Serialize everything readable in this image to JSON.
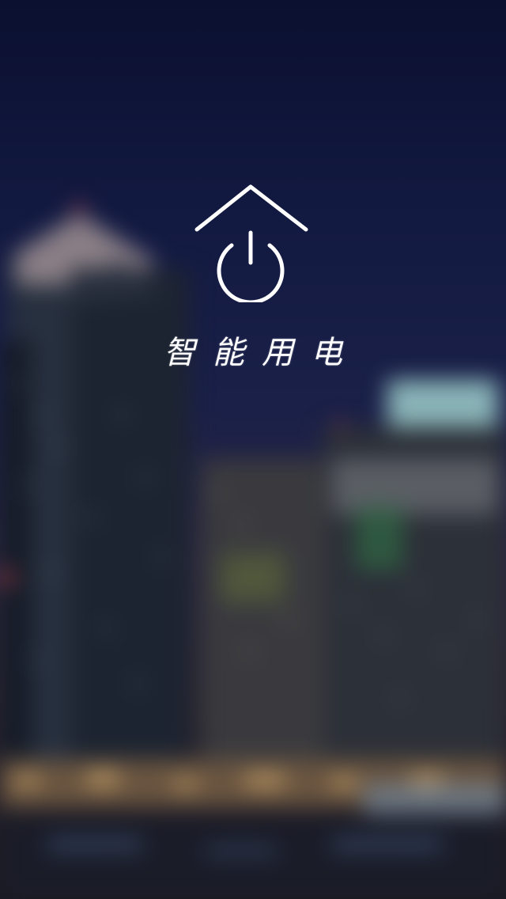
{
  "splash": {
    "title": "智能用电",
    "logo_icon": "house-power-icon"
  },
  "colors": {
    "logo": "#ffffff",
    "title": "#ffffff",
    "sky_top": "#0b1030",
    "sky_mid": "#1a2048"
  }
}
